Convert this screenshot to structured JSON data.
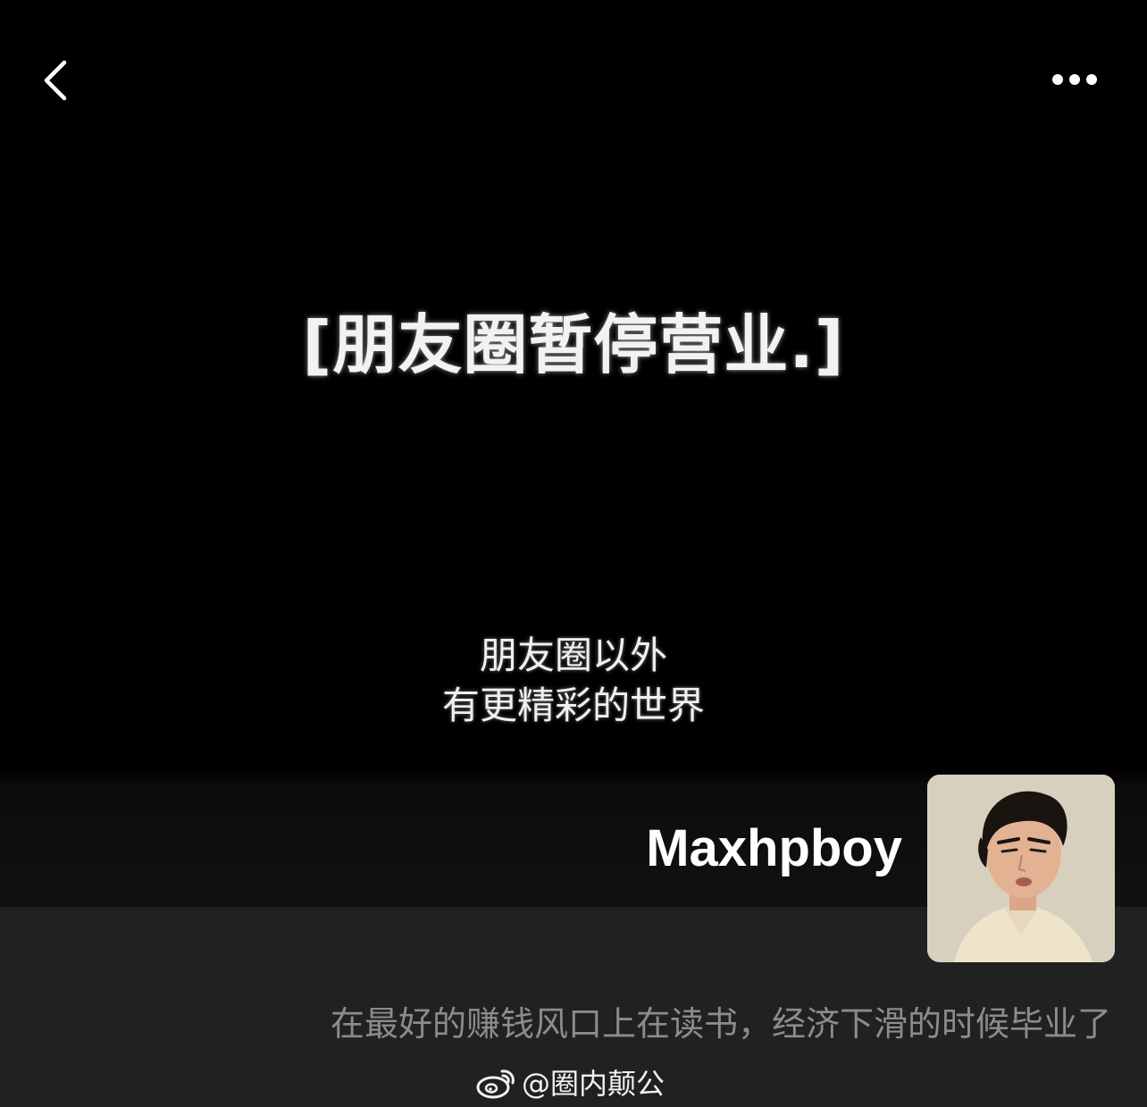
{
  "header": {
    "back_icon": "chevron-left-icon",
    "more_icon": "more-horizontal-icon"
  },
  "cover": {
    "headline": "[朋友圈暂停营业.]",
    "subtext_lines": [
      "朋友圈以外",
      "有更精彩的世界"
    ]
  },
  "profile": {
    "username": "Maxhpboy",
    "signature": "在最好的赚钱风口上在读书，经济下滑的时候毕业了"
  },
  "watermark": {
    "icon": "weibo-logo-icon",
    "text": "@圈内颠公"
  },
  "colors": {
    "background": "#000000",
    "lower_panel": "#212121",
    "signature_text": "#8c8c8c",
    "primary_text": "#ffffff"
  }
}
